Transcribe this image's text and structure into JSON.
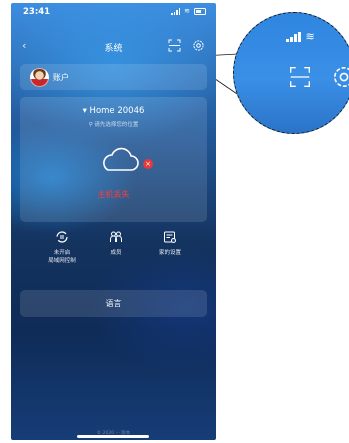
{
  "status_bar": {
    "time": "23:41"
  },
  "navbar": {
    "back_icon": "chevron-left-icon",
    "title": "系统"
  },
  "account": {
    "label": "账户"
  },
  "home": {
    "name": "▾ Home 20046",
    "location_hint": "⚲ 请先选择您的位置",
    "host_status": "主机丢失",
    "error_badge": "×"
  },
  "actions": [
    {
      "icon": "sync-icon",
      "label_line1": "未开启",
      "label_line2": "局域网控制"
    },
    {
      "icon": "members-icon",
      "label_line1": "成员",
      "label_line2": ""
    },
    {
      "icon": "home-settings-icon",
      "label_line1": "家的设置",
      "label_line2": ""
    }
  ],
  "language": {
    "label": "语言"
  },
  "footer": {
    "text": "© 2020 ··· 版本"
  },
  "colors": {
    "accent_error": "#e5393b",
    "background_top": "#3d8ee0",
    "background_bottom": "#14335f"
  }
}
